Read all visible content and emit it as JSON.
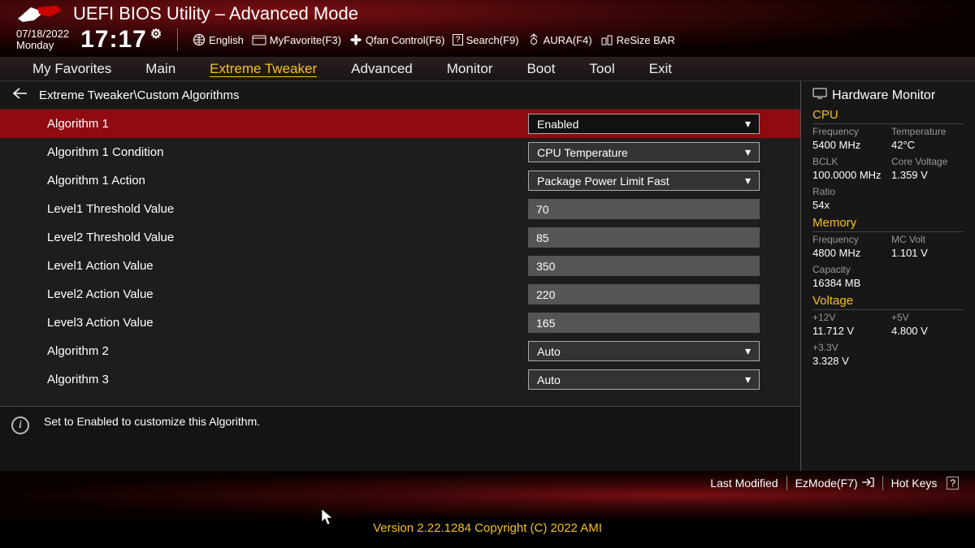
{
  "header": {
    "title": "UEFI BIOS Utility – Advanced Mode",
    "date": "07/18/2022",
    "day": "Monday",
    "time": "17:17"
  },
  "toolbar": {
    "language": "English",
    "favorite": "MyFavorite(F3)",
    "qfan": "Qfan Control(F6)",
    "search": "Search(F9)",
    "aura": "AURA(F4)",
    "resize": "ReSize BAR"
  },
  "tabs": [
    "My Favorites",
    "Main",
    "Extreme Tweaker",
    "Advanced",
    "Monitor",
    "Boot",
    "Tool",
    "Exit"
  ],
  "active_tab": "Extreme Tweaker",
  "breadcrumb": "Extreme Tweaker\\Custom Algorithms",
  "settings": [
    {
      "label": "Algorithm 1",
      "type": "select",
      "value": "Enabled",
      "selected": true
    },
    {
      "label": "Algorithm 1 Condition",
      "type": "select",
      "value": "CPU Temperature"
    },
    {
      "label": "Algorithm 1 Action",
      "type": "select",
      "value": "Package Power Limit Fast"
    },
    {
      "label": "Level1 Threshold Value",
      "type": "input",
      "value": "70"
    },
    {
      "label": "Level2 Threshold Value",
      "type": "input",
      "value": "85"
    },
    {
      "label": "Level1 Action Value",
      "type": "input",
      "value": "350"
    },
    {
      "label": "Level2 Action Value",
      "type": "input",
      "value": "220"
    },
    {
      "label": "Level3 Action Value",
      "type": "input",
      "value": "165"
    },
    {
      "label": "Algorithm 2",
      "type": "select",
      "value": "Auto"
    },
    {
      "label": "Algorithm 3",
      "type": "select",
      "value": "Auto"
    }
  ],
  "help": "Set to Enabled to customize this Algorithm.",
  "hw": {
    "title": "Hardware Monitor",
    "cpu": {
      "heading": "CPU",
      "freq_l": "Frequency",
      "freq_v": "5400 MHz",
      "temp_l": "Temperature",
      "temp_v": "42°C",
      "bclk_l": "BCLK",
      "bclk_v": "100.0000 MHz",
      "cv_l": "Core Voltage",
      "cv_v": "1.359 V",
      "ratio_l": "Ratio",
      "ratio_v": "54x"
    },
    "mem": {
      "heading": "Memory",
      "freq_l": "Frequency",
      "freq_v": "4800 MHz",
      "mc_l": "MC Volt",
      "mc_v": "1.101 V",
      "cap_l": "Capacity",
      "cap_v": "16384 MB"
    },
    "volt": {
      "heading": "Voltage",
      "v12_l": "+12V",
      "v12_v": "11.712 V",
      "v5_l": "+5V",
      "v5_v": "4.800 V",
      "v33_l": "+3.3V",
      "v33_v": "3.328 V"
    }
  },
  "footer": {
    "last_modified": "Last Modified",
    "ezmode": "EzMode(F7)",
    "hotkeys": "Hot Keys",
    "version": "Version 2.22.1284 Copyright (C) 2022 AMI"
  }
}
